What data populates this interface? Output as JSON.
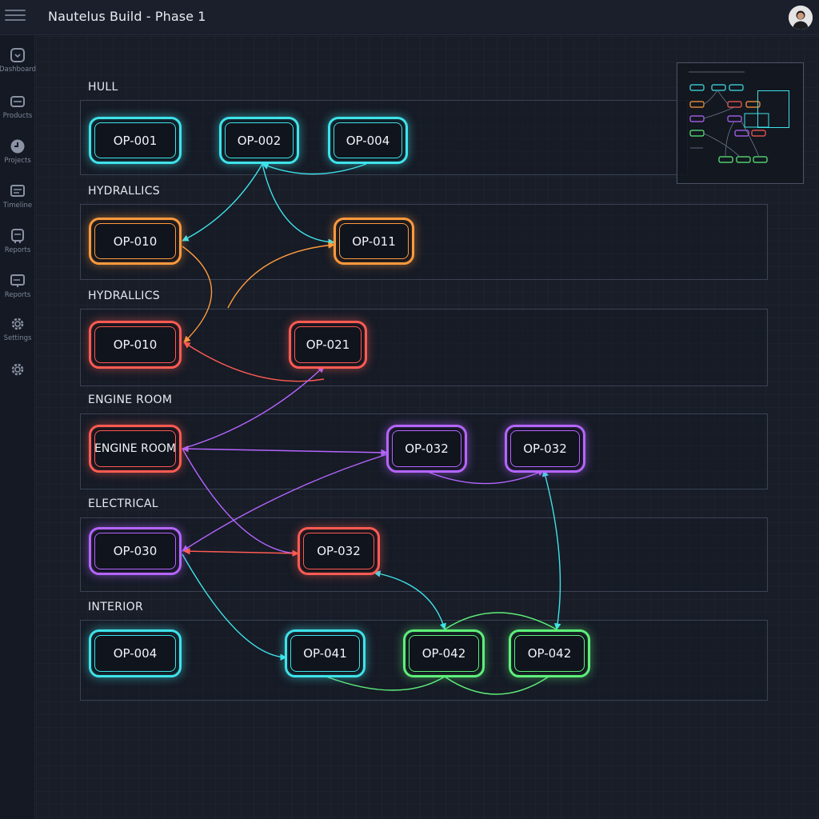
{
  "header": {
    "title": "Nautelus Build - Phase 1",
    "menu_icon": "hamburger-menu-icon",
    "avatar_icon": "user-avatar-icon"
  },
  "sidebar": {
    "items": [
      {
        "label": "Dashboard",
        "icon": "dashboard-icon"
      },
      {
        "label": "Products",
        "icon": "products-icon"
      },
      {
        "label": "Projects",
        "icon": "projects-icon"
      },
      {
        "label": "Timeline",
        "icon": "timeline-icon"
      },
      {
        "label": "Reports",
        "icon": "reports-icon"
      },
      {
        "label": "Reports",
        "icon": "reports-icon"
      },
      {
        "label": "Settings",
        "icon": "gear-icon"
      },
      {
        "label": "",
        "icon": "gear-icon"
      }
    ]
  },
  "colors": {
    "cyan": "#3fe3ea",
    "orange": "#ff9a3d",
    "red": "#ff5b52",
    "purple": "#b565ff",
    "green": "#5ef07a",
    "background": "#161b26"
  },
  "lanes": [
    {
      "label": "HULL"
    },
    {
      "label": "HYDRALLICS"
    },
    {
      "label": "HYDRALLICS"
    },
    {
      "label": "ENGINE ROOM"
    },
    {
      "label": "ELECTRICAL"
    },
    {
      "label": "INTERIOR"
    }
  ],
  "nodes": {
    "n1": {
      "label": "OP-001",
      "color": "cyan"
    },
    "n2": {
      "label": "OP-002",
      "color": "cyan"
    },
    "n3": {
      "label": "OP-004",
      "color": "cyan"
    },
    "n4": {
      "label": "OP-010",
      "color": "orange"
    },
    "n5": {
      "label": "OP-011",
      "color": "orange"
    },
    "n6": {
      "label": "OP-010",
      "color": "red"
    },
    "n7": {
      "label": "OP-021",
      "color": "red"
    },
    "n8": {
      "label": "ENGINE ROOM",
      "color": "red"
    },
    "n9": {
      "label": "OP-032",
      "color": "purple"
    },
    "n10": {
      "label": "OP-032",
      "color": "purple"
    },
    "n11": {
      "label": "OP-030",
      "color": "purple"
    },
    "n12": {
      "label": "OP-032",
      "color": "red"
    },
    "n13": {
      "label": "OP-004",
      "color": "cyan"
    },
    "n14": {
      "label": "OP-041",
      "color": "cyan"
    },
    "n15": {
      "label": "OP-042",
      "color": "green"
    },
    "n16": {
      "label": "OP-042",
      "color": "green"
    }
  },
  "edges": [
    {
      "from": "n2",
      "to": "n3",
      "color": "cyan"
    },
    {
      "from": "n2",
      "to": "n4",
      "color": "cyan"
    },
    {
      "from": "n2",
      "to": "n5",
      "color": "cyan"
    },
    {
      "from": "n4",
      "to": "n6",
      "color": "orange"
    },
    {
      "from": "n6",
      "to": "n5",
      "color": "orange"
    },
    {
      "from": "n7",
      "to": "n6",
      "color": "red"
    },
    {
      "from": "n8",
      "to": "n7",
      "color": "purple"
    },
    {
      "from": "n8",
      "to": "n9",
      "color": "purple"
    },
    {
      "from": "n9",
      "to": "n10",
      "color": "purple"
    },
    {
      "from": "n8",
      "to": "n12",
      "color": "purple"
    },
    {
      "from": "n11",
      "to": "n9",
      "color": "purple"
    },
    {
      "from": "n12",
      "to": "n11",
      "color": "red"
    },
    {
      "from": "n11",
      "to": "n14",
      "color": "cyan"
    },
    {
      "from": "n10",
      "to": "n16",
      "color": "cyan"
    },
    {
      "from": "n12",
      "to": "n15",
      "color": "cyan"
    },
    {
      "from": "n15",
      "to": "n16",
      "color": "green"
    },
    {
      "from": "n14",
      "to": "n16",
      "color": "green"
    }
  ],
  "minimap": {
    "label": "minimap"
  }
}
